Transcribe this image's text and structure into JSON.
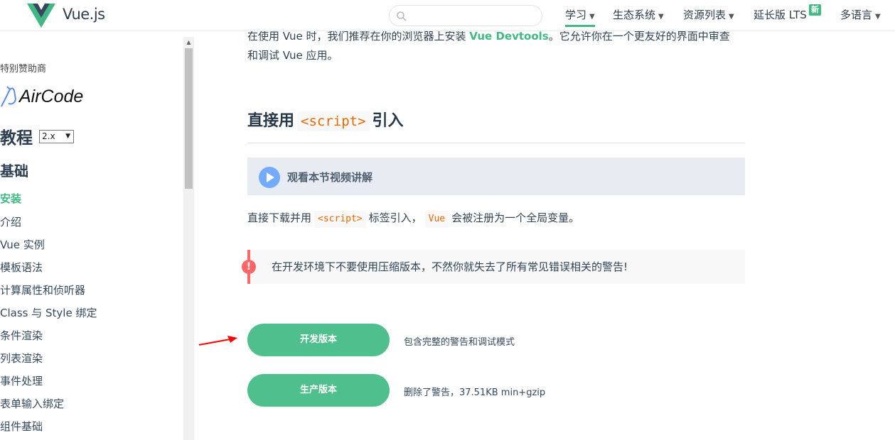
{
  "header": {
    "brand": "Vue.js",
    "search": {
      "placeholder": "",
      "value": ""
    },
    "nav": [
      {
        "label": "学习",
        "active": true
      },
      {
        "label": "生态系统"
      },
      {
        "label": "资源列表"
      },
      {
        "label": "延长版 LTS",
        "badge": "新"
      },
      {
        "label": "多语言"
      }
    ]
  },
  "sidebar": {
    "sponsor_label": "特别赞助商",
    "sponsor_name": "AirCode",
    "tutorial_title": "教程",
    "version": "2.x",
    "section_title": "基础",
    "items": [
      {
        "label": "安装",
        "active": true
      },
      {
        "label": "介绍"
      },
      {
        "label": "Vue 实例"
      },
      {
        "label": "模板语法"
      },
      {
        "label": "计算属性和侦听器"
      },
      {
        "label": "Class 与 Style 绑定"
      },
      {
        "label": "条件渲染"
      },
      {
        "label": "列表渲染"
      },
      {
        "label": "事件处理"
      },
      {
        "label": "表单输入绑定"
      },
      {
        "label": "组件基础"
      }
    ]
  },
  "main": {
    "intro_line1_a": "在使用 Vue 时，我们推荐在你的浏览器上安装 ",
    "intro_link": "Vue Devtools",
    "intro_line1_b": "。它允许你在一个更友好的界面中审查",
    "intro_line2": "和调试 Vue 应用。",
    "heading_a": "直接用",
    "heading_code": "<script>",
    "heading_b": "引入",
    "video_label": "观看本节视频讲解",
    "para_a": "直接下载并用",
    "para_code1": "<script>",
    "para_b": "标签引入，",
    "para_code2": "Vue",
    "para_c": "会被注册为一个全局变量。",
    "warning_icon": "!",
    "warning_text": "在开发环境下不要使用压缩版本，不然你就失去了所有常见错误相关的警告!",
    "downloads": [
      {
        "label": "开发版本",
        "desc": "包含完整的警告和调试模式"
      },
      {
        "label": "生产版本",
        "desc": "删除了警告，37.51KB min+gzip"
      }
    ]
  },
  "colors": {
    "accent": "#42b983",
    "button": "#4fc08d",
    "warning": "#ff6666",
    "code": "#e96900"
  }
}
